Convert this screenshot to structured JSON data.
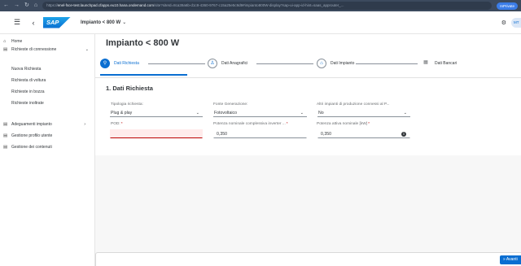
{
  "browser": {
    "url_dim": "https://",
    "url_host": "enel-fsce-test.launchpad.cfapps.eu10.hana.ondemand.com",
    "url_rest": "/site?siteId=8ca39a6b-d1c8-4360-9767-c15a25e5c9d9#impianto800W-display?sap-ui-app-id-hint=saas_approuter_...",
    "profile": "InPrivate",
    "glyphs": {
      "back": "←",
      "forward": "→",
      "reload": "↻",
      "home": "⌂"
    }
  },
  "shell": {
    "menu_icon": "☰",
    "back_icon": "‹",
    "logo_text": "SAP",
    "app_title": "Impianto < 800 W",
    "app_title_chevron": "⌄",
    "settings_icon": "⚙",
    "avatar_initials": "MT"
  },
  "sidebar": {
    "items": [
      {
        "label": "Home",
        "icon": "⌂"
      },
      {
        "label": "Richieste di connessione",
        "icon": "▤",
        "arrow": "⌄"
      },
      {
        "label": "Adeguamenti impianto",
        "icon": "▤",
        "arrow": "›"
      },
      {
        "label": "Gestione profilo utente",
        "icon": "▤"
      },
      {
        "label": "Gestione dei contenuti",
        "icon": "▤"
      }
    ],
    "subitems": [
      {
        "label": "Nuova Richiesta"
      },
      {
        "label": "Richiesta di voltura"
      },
      {
        "label": "Richieste in bozza"
      },
      {
        "label": "Richieste inoltrate"
      }
    ]
  },
  "page": {
    "title": "Impianto < 800 W",
    "steps": [
      {
        "label": "Dati Richiesta",
        "icon": "⚲"
      },
      {
        "label": "Dati Anagrafici",
        "icon": "♙"
      },
      {
        "label": "Dati Impianto",
        "icon": "⌂"
      },
      {
        "label": "Dati Bancari",
        "icon": "▦"
      }
    ]
  },
  "form": {
    "section_title": "1. Dati Richiesta",
    "tipologia": {
      "label": "Tipologia richiesta:",
      "value": "Plug & play"
    },
    "fonte": {
      "label": "Fonte Generazione:",
      "value": "Fotovoltaico"
    },
    "altri": {
      "label": "Altri impianti di produzione connessi al P...",
      "value": "No"
    },
    "pod": {
      "label": "POD:",
      "required": "*",
      "value": ""
    },
    "potenza_inverter": {
      "label": "Potenza nominale complessiva inverter ...",
      "required": "*",
      "value": "0,350"
    },
    "potenza_attiva": {
      "label": "Potenza attiva nominale [kW]",
      "required": "*",
      "value": "0,350"
    },
    "chevron": "⌄",
    "info_icon": "i"
  },
  "footer": {
    "next_label": "Avanti",
    "next_icon": "»"
  }
}
